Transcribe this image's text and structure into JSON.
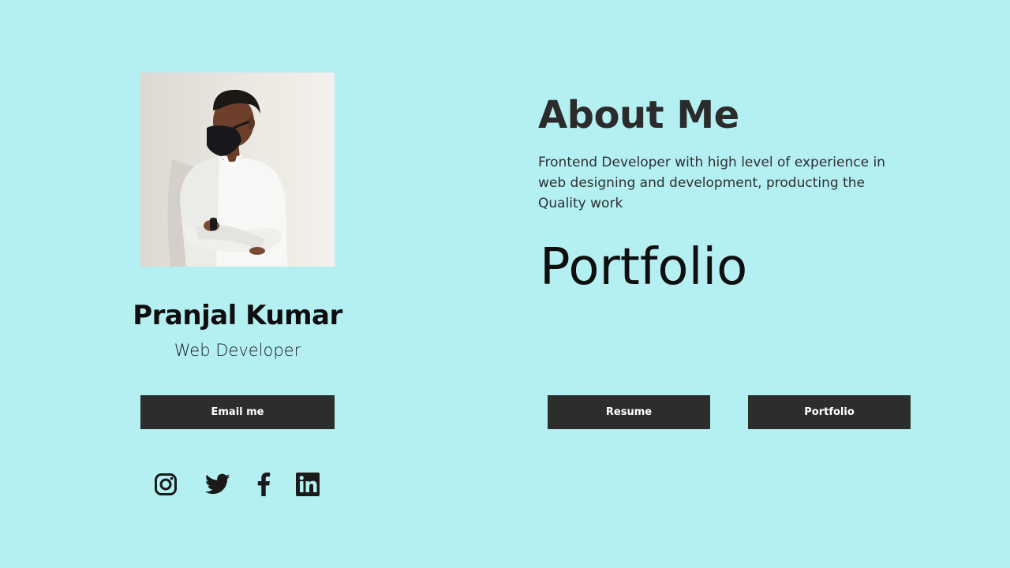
{
  "profile": {
    "name": "Pranjal Kumar",
    "role": "Web Developer",
    "photo": "profile-photo"
  },
  "buttons": {
    "email": "Email me",
    "resume": "Resume",
    "portfolio": "Portfolio"
  },
  "socials": [
    {
      "icon": "instagram-icon"
    },
    {
      "icon": "twitter-icon"
    },
    {
      "icon": "facebook-icon"
    },
    {
      "icon": "linkedin-icon"
    }
  ],
  "about": {
    "title": "About Me",
    "text": "Frontend Developer with high level of experience in web designing and development, producting the Quality work"
  },
  "portfolio": {
    "title": "Portfolio"
  },
  "colors": {
    "background": "#b4eff2",
    "button": "#2d2d2d",
    "button_text": "#ffffff"
  }
}
